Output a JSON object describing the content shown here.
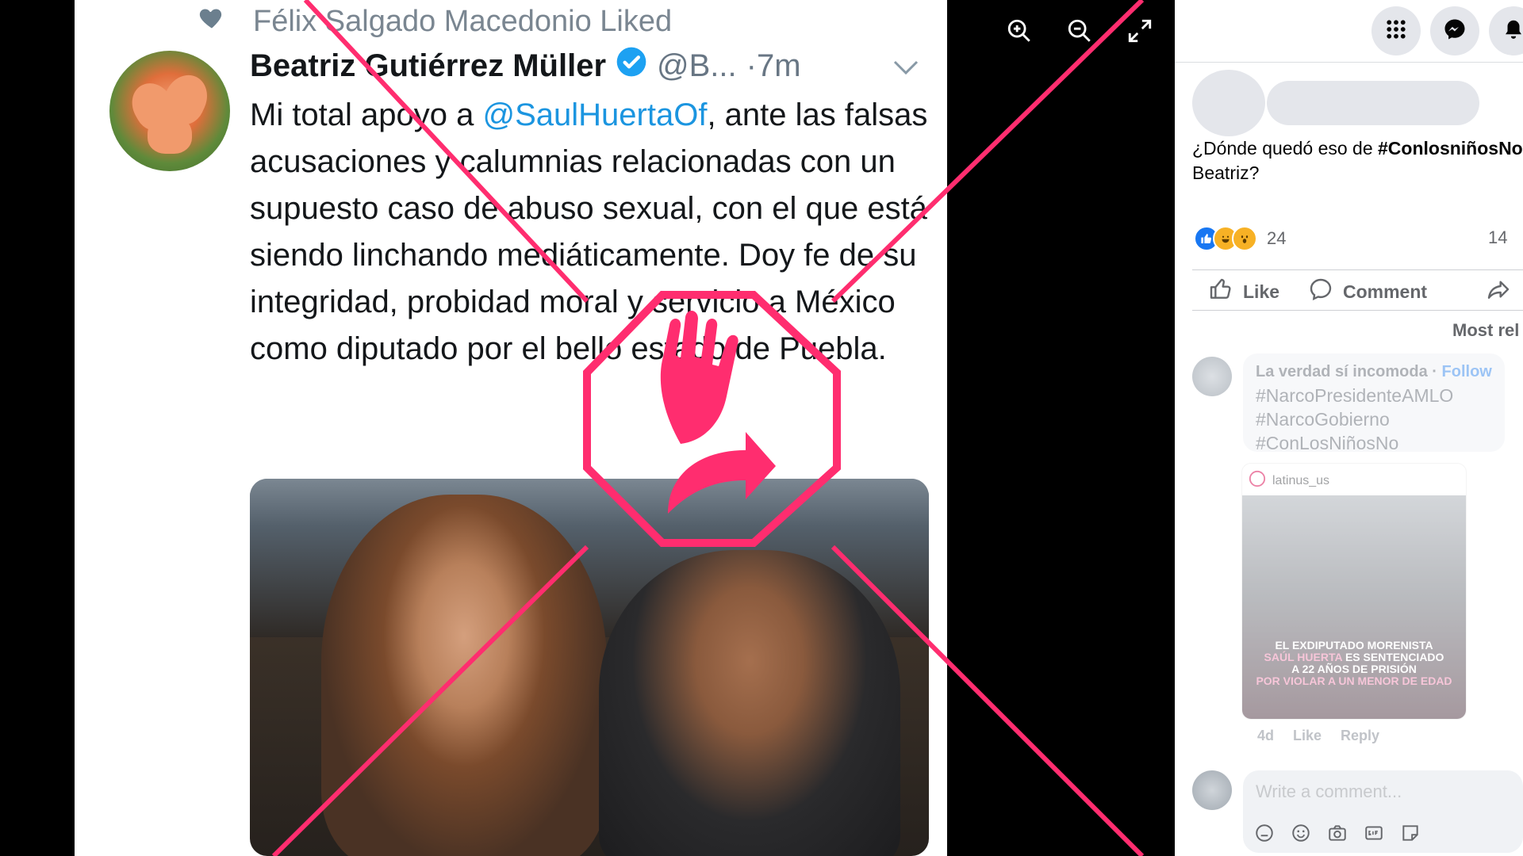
{
  "viewer": {
    "liked_by": "Félix Salgado Macedonio Liked",
    "author_name": "Beatriz Gutiérrez Müller",
    "author_handle": "@B...",
    "time": "·7m",
    "tweet_text_before": "Mi total apoyo a ",
    "tweet_mention": "@SaulHuertaOf",
    "tweet_text_after": ", ante las falsas acusaciones y calumnias relacionadas con un supuesto caso de abuso sexual, con el que está siendo linchando mediáticamente. Doy fe de su integridad, probidad moral y servicio a México como diputado por el bello estado de Puebla.",
    "zoom_in_icon": "zoom-in-icon",
    "zoom_out_icon": "zoom-out-icon",
    "fullscreen_icon": "fullscreen-icon",
    "overlay_color": "#ff2d6f",
    "verified_color": "#1da1f2",
    "mention_color": "#1b95e0"
  },
  "facebook": {
    "post_text_prefix": "¿Dónde quedó eso de ",
    "post_hashtag": "#ConlosniñosNo",
    "post_text_line2": "Beatriz?",
    "reaction_count": "24",
    "comment_count": "14",
    "actions": {
      "like": "Like",
      "comment": "Comment"
    },
    "sort_label": "Most rel",
    "comment": {
      "author": "La verdad sí incomoda",
      "follow": "Follow",
      "tags": [
        "#NarcoPresidenteAMLO",
        "#NarcoGobierno",
        "#ConLosNiñosNo"
      ],
      "shared_account": "latinus_us",
      "shared_headline_1": "EL EXDIPUTADO MORENISTA",
      "shared_headline_2_pink": "SAÚL HUERTA",
      "shared_headline_2_white": " ES SENTENCIADO",
      "shared_headline_3": "A 22 AÑOS DE PRISIÓN",
      "shared_headline_4": "POR VIOLAR A UN MENOR DE EDAD",
      "age": "4d",
      "like": "Like",
      "reply": "Reply"
    },
    "write_placeholder": "Write a comment..."
  }
}
